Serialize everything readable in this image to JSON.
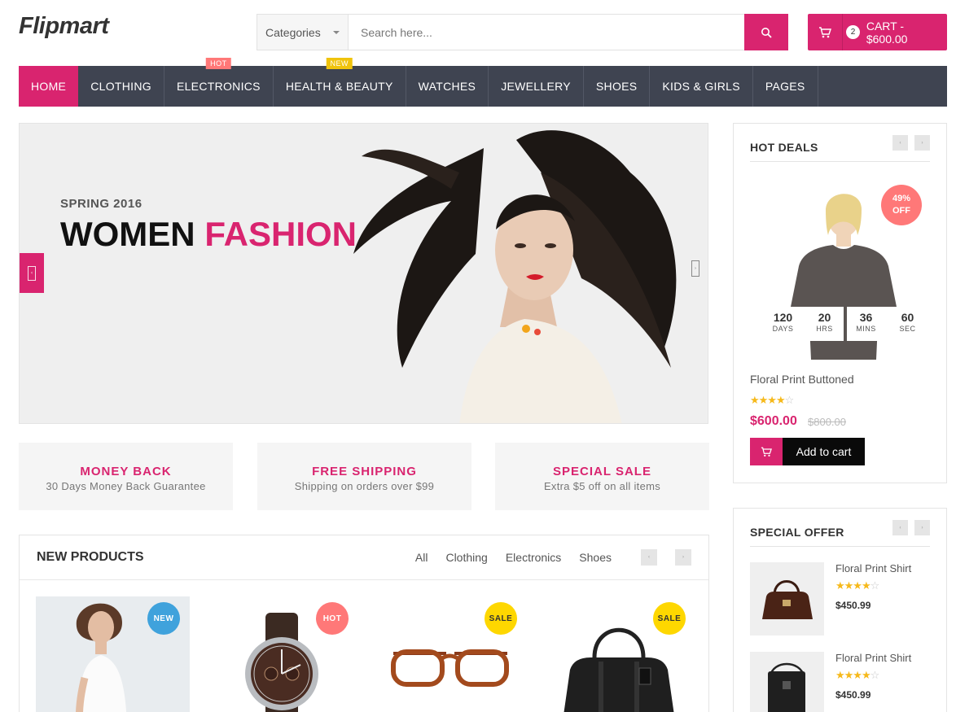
{
  "header": {
    "logo": "Flipmart",
    "category_select": "Categories",
    "search_placeholder": "Search here...",
    "cart_count": "2",
    "cart_label": "CART - $600.00"
  },
  "nav": {
    "items": [
      {
        "label": "HOME",
        "active": true
      },
      {
        "label": "CLOTHING"
      },
      {
        "label": "ELECTRONICS",
        "badge": "HOT"
      },
      {
        "label": "HEALTH & BEAUTY",
        "badge": "NEW"
      },
      {
        "label": "WATCHES"
      },
      {
        "label": "JEWELLERY"
      },
      {
        "label": "SHOES"
      },
      {
        "label": "KIDS & GIRLS"
      },
      {
        "label": "PAGES"
      }
    ]
  },
  "hero": {
    "subtitle": "SPRING 2016",
    "title_part1": "WOMEN",
    "title_part2": "FASHION"
  },
  "info_boxes": [
    {
      "title": "MONEY BACK",
      "text": "30 Days Money Back Guarantee"
    },
    {
      "title": "FREE SHIPPING",
      "text": "Shipping on orders over $99"
    },
    {
      "title": "SPECIAL SALE",
      "text": "Extra $5 off on all items"
    }
  ],
  "new_products": {
    "title": "NEW PRODUCTS",
    "tabs": [
      "All",
      "Clothing",
      "Electronics",
      "Shoes"
    ],
    "items": [
      {
        "tag": "NEW",
        "icon": "woman-model-image"
      },
      {
        "tag": "HOT",
        "icon": "watch-image"
      },
      {
        "tag": "SALE",
        "icon": "glasses-image"
      },
      {
        "tag": "SALE",
        "icon": "bag-image"
      }
    ]
  },
  "hot_deals": {
    "title": "HOT DEALS",
    "discount_line1": "49%",
    "discount_line2": "OFF",
    "timer": [
      {
        "value": "120",
        "unit": "DAYS"
      },
      {
        "value": "20",
        "unit": "HRS"
      },
      {
        "value": "36",
        "unit": "MINS"
      },
      {
        "value": "60",
        "unit": "SEC"
      }
    ],
    "product_name": "Floral Print Buttoned",
    "rating": 4,
    "price": "$600.00",
    "old_price": "$800.00",
    "button": "Add to cart"
  },
  "special_offer": {
    "title": "SPECIAL OFFER",
    "items": [
      {
        "name": "Floral Print Shirt",
        "rating": 4,
        "price": "$450.99"
      },
      {
        "name": "Floral Print Shirt",
        "rating": 4,
        "price": "$450.99"
      }
    ]
  },
  "colors": {
    "accent": "#d9246f",
    "nav_bg": "#3f4451",
    "hot": "#ff7878",
    "new": "#3fa2dc",
    "sale": "#fed700"
  }
}
